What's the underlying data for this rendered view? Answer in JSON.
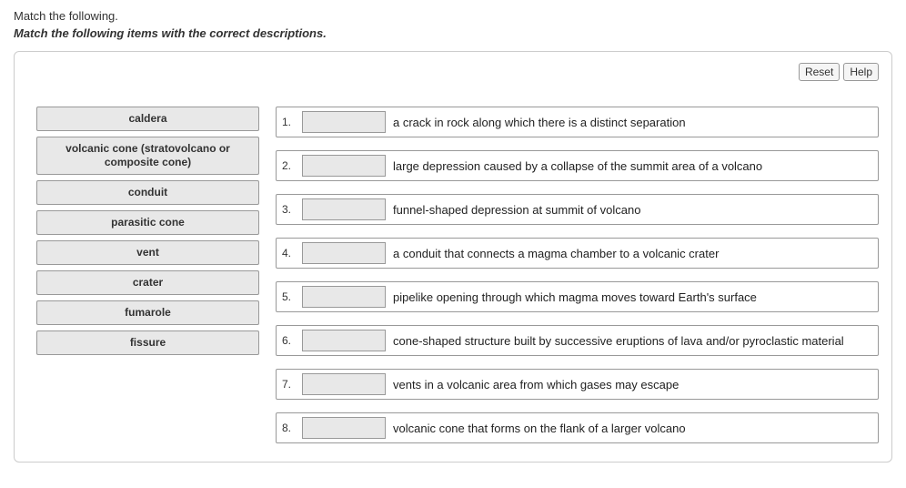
{
  "header": {
    "line1": "Match the following.",
    "line2": "Match the following items with the correct descriptions."
  },
  "toolbar": {
    "reset_label": "Reset",
    "help_label": "Help"
  },
  "terms": [
    {
      "label": "caldera",
      "tall": false
    },
    {
      "label": "volcanic cone (stratovolcano or composite cone)",
      "tall": true
    },
    {
      "label": "conduit",
      "tall": false
    },
    {
      "label": "parasitic cone",
      "tall": false
    },
    {
      "label": "vent",
      "tall": false
    },
    {
      "label": "crater",
      "tall": false
    },
    {
      "label": "fumarole",
      "tall": false
    },
    {
      "label": "fissure",
      "tall": false
    }
  ],
  "descriptions": [
    {
      "num": "1.",
      "text": "a crack in rock along which there is a distinct separation"
    },
    {
      "num": "2.",
      "text": "large depression caused by a collapse of the summit area of a volcano"
    },
    {
      "num": "3.",
      "text": "funnel-shaped depression at summit of volcano"
    },
    {
      "num": "4.",
      "text": "a conduit that connects a magma chamber to a volcanic crater"
    },
    {
      "num": "5.",
      "text": "pipelike opening through which magma moves toward Earth's surface"
    },
    {
      "num": "6.",
      "text": "cone-shaped structure built by successive eruptions of lava and/or pyroclastic material"
    },
    {
      "num": "7.",
      "text": "vents in a volcanic area from which gases may escape"
    },
    {
      "num": "8.",
      "text": "volcanic cone that forms on the flank of a larger volcano"
    }
  ]
}
